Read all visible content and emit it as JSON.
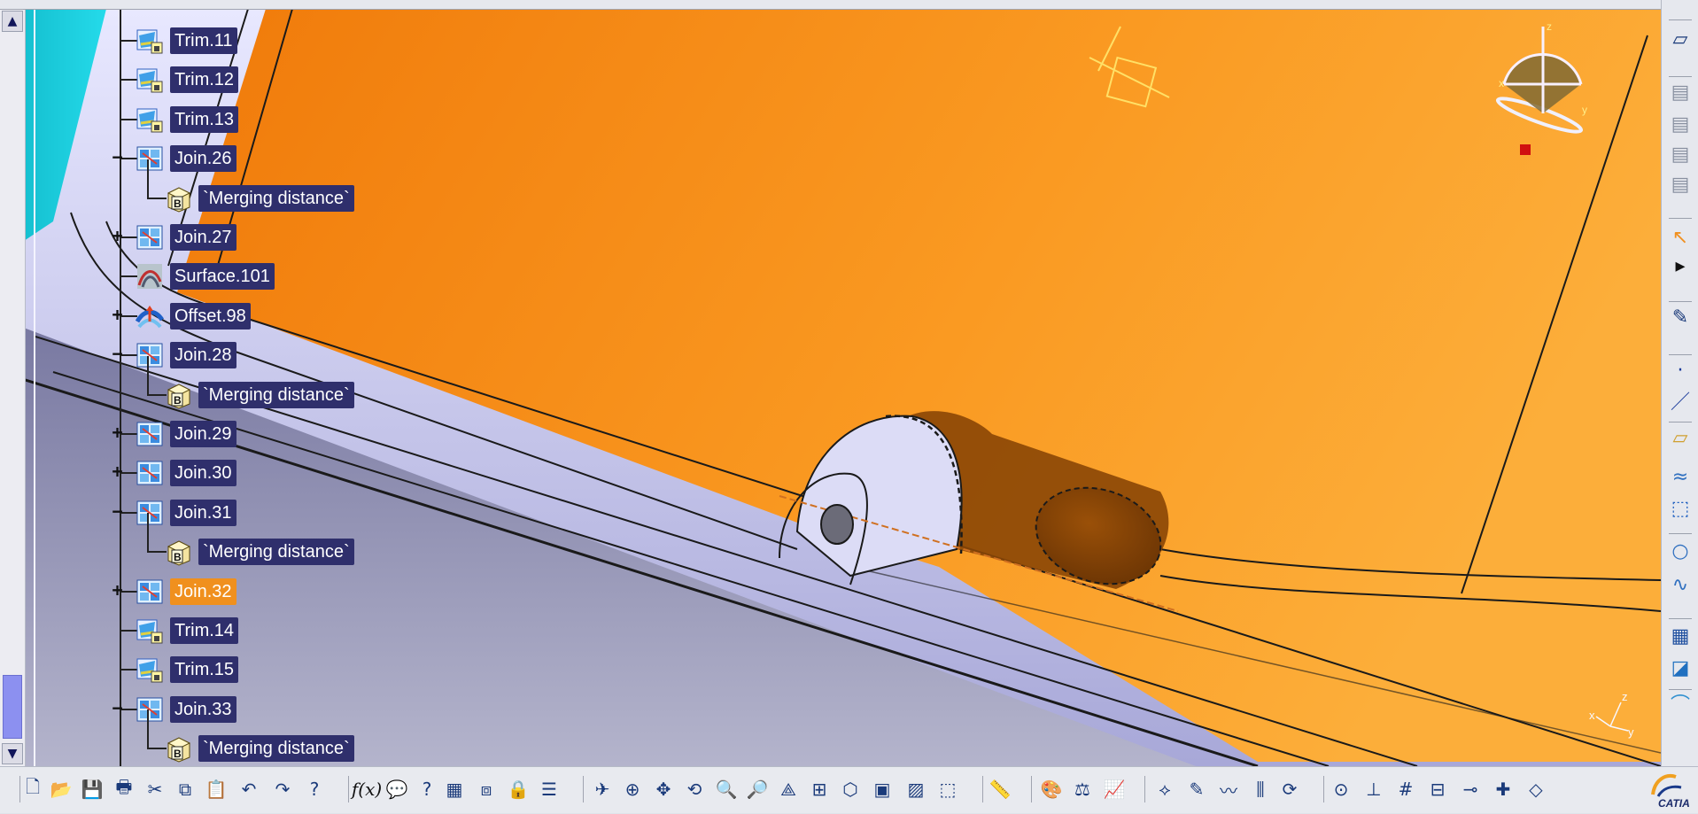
{
  "tree": {
    "nodes": [
      {
        "label": "Trim.11",
        "icon": "trim-surface-icon",
        "expander": ""
      },
      {
        "label": "Trim.12",
        "icon": "trim-surface-icon",
        "expander": ""
      },
      {
        "label": "Trim.13",
        "icon": "trim-surface-icon",
        "expander": ""
      },
      {
        "label": "Join.26",
        "icon": "join-icon",
        "expander": "−"
      },
      {
        "label": "`Merging distance`",
        "icon": "parameter-icon",
        "expander": ""
      },
      {
        "label": "Join.27",
        "icon": "join-icon",
        "expander": "+"
      },
      {
        "label": "Surface.101",
        "icon": "surface-icon",
        "expander": ""
      },
      {
        "label": "Offset.98",
        "icon": "offset-icon",
        "expander": "+"
      },
      {
        "label": "Join.28",
        "icon": "join-icon",
        "expander": "−"
      },
      {
        "label": "`Merging distance`",
        "icon": "parameter-icon",
        "expander": ""
      },
      {
        "label": "Join.29",
        "icon": "join-icon",
        "expander": "+"
      },
      {
        "label": "Join.30",
        "icon": "join-icon",
        "expander": "+"
      },
      {
        "label": "Join.31",
        "icon": "join-icon",
        "expander": "−"
      },
      {
        "label": "`Merging distance`",
        "icon": "parameter-icon",
        "expander": ""
      },
      {
        "label": "Join.32",
        "icon": "join-icon",
        "expander": "+",
        "active": true
      },
      {
        "label": "Trim.14",
        "icon": "trim-surface-icon",
        "expander": ""
      },
      {
        "label": "Trim.15",
        "icon": "trim-surface-icon",
        "expander": ""
      },
      {
        "label": "Join.33",
        "icon": "join-icon",
        "expander": "−"
      },
      {
        "label": "`Merging distance`",
        "icon": "parameter-icon",
        "expander": ""
      }
    ]
  },
  "scrollbar": {
    "up": "▲",
    "down": "▼"
  },
  "compass_axes": {
    "x": "x",
    "y": "y",
    "z": "z"
  },
  "axis_triad": {
    "x": "x",
    "y": "y",
    "z": "z"
  },
  "bottom_toolbar": {
    "formula_label": "f(x)"
  },
  "brand": {
    "logo_text": "CATIA"
  },
  "colors": {
    "tree_label_bg": "#2f2f6c",
    "active_label_bg": "#f0901e",
    "part_orange": "#f28a10",
    "part_lavender": "#c8c8f0",
    "background_top": "#5a5a8c",
    "background_bottom": "#a8a8c8"
  },
  "right_toolbar": {
    "icons": [
      "sketcher-icon",
      "capture-icon",
      "capture-icon-2",
      "capture-icon-3",
      "capture-icon-4",
      "select-arrow-icon",
      "expand-arrow-icon",
      "sketch-icon",
      "point-icon",
      "line-icon",
      "plane-icon",
      "extrude-surface-icon",
      "offset-surface-icon",
      "circle-icon",
      "spline-icon",
      "join-surface-icon",
      "healing-icon",
      "fill-surface-icon"
    ]
  },
  "bottom_toolbar_icons": [
    "new-file-icon",
    "open-file-icon",
    "save-icon",
    "print-icon",
    "cut-icon",
    "copy-icon",
    "paste-icon",
    "undo-icon",
    "redo-icon",
    "whats-this-icon",
    "formula-icon",
    "comment-icon",
    "knowledge-icon",
    "table-icon",
    "design-table-icon",
    "lock-icon",
    "list-icon",
    "fly-mode-icon",
    "fit-all-icon",
    "pan-icon",
    "rotate-icon",
    "zoom-in-icon",
    "zoom-out-icon",
    "normal-view-icon",
    "multi-view-icon",
    "iso-view-icon",
    "render-style-icon",
    "hide-show-icon",
    "swap-visible-icon",
    "measure-icon",
    "apply-material-icon",
    "mass-icon",
    "analysis-icon",
    "connect-checker-icon",
    "curvature-icon",
    "draft-analysis-icon",
    "porcupine-icon",
    "update-icon",
    "compass-manip-icon",
    "axis-system-icon",
    "grid-icon",
    "work-on-support-icon",
    "snap-icon",
    "plane-view-icon",
    "feature-icon"
  ]
}
